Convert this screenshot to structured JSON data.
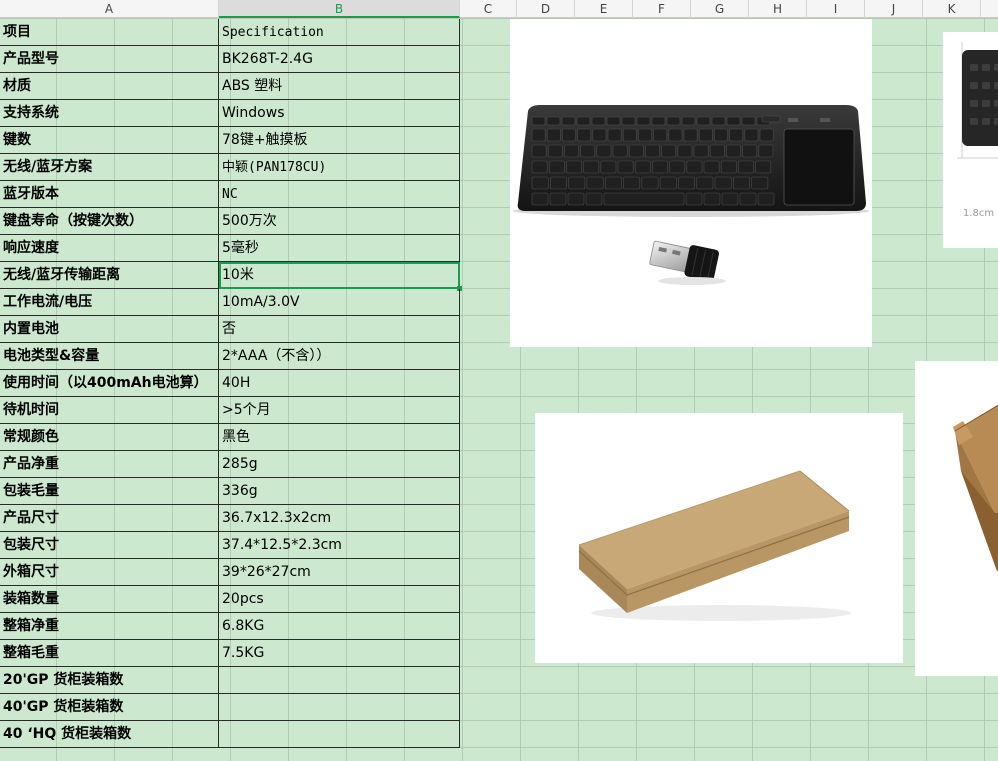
{
  "columns": [
    "A",
    "B",
    "C",
    "D",
    "E",
    "F",
    "G",
    "H",
    "I",
    "J",
    "K"
  ],
  "selected_column": "B",
  "rows": [
    {
      "label": "项目",
      "value": "Specification",
      "mono": true
    },
    {
      "label": "产品型号",
      "value": "BK268T-2.4G"
    },
    {
      "label": "材质",
      "value": "ABS 塑料"
    },
    {
      "label": "支持系统",
      "value": "Windows"
    },
    {
      "label": "键数",
      "value": "78键+触摸板"
    },
    {
      "label": "无线/蓝牙方案",
      "value": "中颖(PAN178CU)",
      "mono": true
    },
    {
      "label": "蓝牙版本",
      "value": "NC",
      "mono": true
    },
    {
      "label": "键盘寿命（按键次数）",
      "value": "500万次"
    },
    {
      "label": "响应速度",
      "value": "5毫秒"
    },
    {
      "label": "无线/蓝牙传输距离",
      "value": "10米",
      "active": true
    },
    {
      "label": "工作电流/电压",
      "value": "10mA/3.0V"
    },
    {
      "label": "内置电池",
      "value": "否"
    },
    {
      "label": "电池类型&容量",
      "value": "2*AAA（不含））"
    },
    {
      "label": "使用时间（以400mAh电池算）",
      "value": "40H"
    },
    {
      "label": "待机时间",
      "value": ">5个月"
    },
    {
      "label": "常规颜色",
      "value": "黑色"
    },
    {
      "label": "产品净重",
      "value": "285g"
    },
    {
      "label": "包装毛量",
      "value": "336g"
    },
    {
      "label": "产品尺寸",
      "value": "36.7x12.3x2cm"
    },
    {
      "label": "包装尺寸",
      "value": "37.4*12.5*2.3cm"
    },
    {
      "label": "外箱尺寸",
      "value": "39*26*27cm"
    },
    {
      "label": "装箱数量",
      "value": "20pcs"
    },
    {
      "label": "整箱净重",
      "value": "6.8KG"
    },
    {
      "label": "整箱毛重",
      "value": "7.5KG"
    },
    {
      "label": "20'GP 货柜装箱数",
      "value": ""
    },
    {
      "label": "40'GP 货柜装箱数",
      "value": ""
    },
    {
      "label": "40 ‘HQ 货柜装箱数",
      "value": ""
    }
  ],
  "images": {
    "keyboard_photo": {
      "icon": "keyboard-with-usb-receiver"
    },
    "box_photo": {
      "icon": "kraft-packaging-box"
    },
    "partial_keyboard_photo": {
      "icon": "keyboard-dimension-drawing",
      "caption": "1.8cm"
    },
    "partial_box_photo": {
      "icon": "open-kraft-box"
    }
  }
}
